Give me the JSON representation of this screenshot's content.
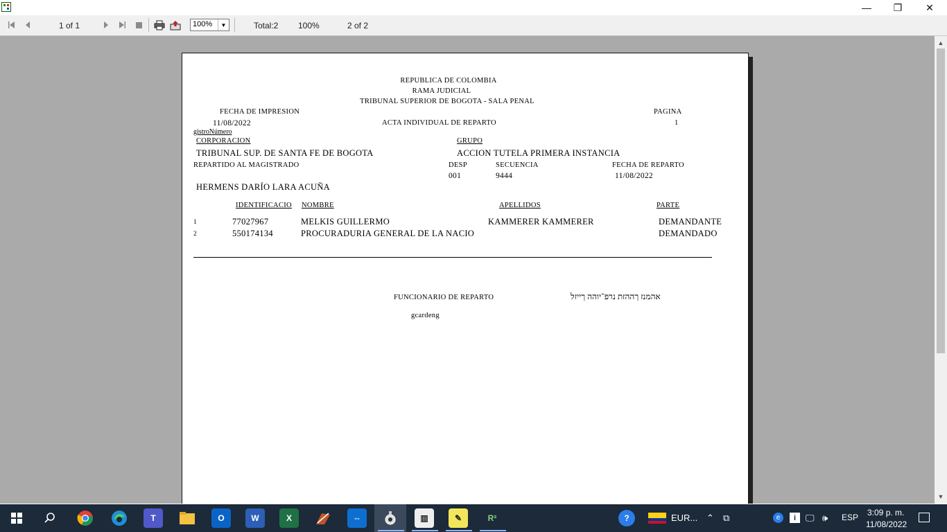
{
  "window": {
    "minimize_glyph": "—",
    "restore_glyph": "❐",
    "close_glyph": "✕"
  },
  "toolbar": {
    "page_indicator": "1 of 1",
    "zoom_value": "100%",
    "total": "Total:2",
    "percent": "100%",
    "records": "2 of 2",
    "icons": [
      "first-page-icon",
      "prev-page-icon",
      "next-page-icon",
      "last-page-icon",
      "stop-icon",
      "print-icon",
      "export-icon"
    ]
  },
  "report": {
    "header_line1": "REPUBLICA DE COLOMBIA",
    "header_line2": "RAMA JUDICIAL",
    "header_line3": "TRIBUNAL SUPERIOR DE BOGOTA - SALA PENAL",
    "fecha_impresion_label": "FECHA DE IMPRESION",
    "fecha_impresion_value": "11/08/2022",
    "pagina_label": "PAGINA",
    "pagina_value": "1",
    "acta_title": "ACTA INDIVIDUAL DE REPARTO",
    "registro_label": "gistroNúmero",
    "corporacion_label": "CORPORACION",
    "corporacion_value": "TRIBUNAL SUP. DE SANTA FE DE BOGOTA",
    "grupo_label": "GRUPO",
    "grupo_value": "ACCION TUTELA PRIMERA INSTANCIA",
    "repartido_label": "REPARTIDO AL MAGISTRADO",
    "desp_label": "DESP",
    "desp_value": "001",
    "secuencia_label": "SECUENCIA",
    "secuencia_value": "9444",
    "fecha_reparto_label": "FECHA DE REPARTO",
    "fecha_reparto_value": "11/08/2022",
    "magistrado": "HERMENS DARÍO LARA ACUÑA",
    "columns": {
      "identificacion": "IDENTIFICACIO",
      "nombre": "NOMBRE",
      "apellidos": "APELLIDOS",
      "parte": "PARTE"
    },
    "rows": [
      {
        "num": "1",
        "id": "77027967",
        "nombre": "MELKIS GUILLERMO",
        "apellidos": "KAMMERER KAMMERER",
        "parte": "DEMANDANTE"
      },
      {
        "num": "2",
        "id": "550174134",
        "nombre": "PROCURADURIA GENERAL DE LA NACIO",
        "apellidos": "",
        "parte": "DEMANDADO"
      }
    ],
    "funcionario_label": "FUNCIONARIO DE REPARTO",
    "hebrew_text": "אהמנז ךההזת נרפ־יוהה ךייזל",
    "usuario": "gcardeng"
  },
  "taskbar": {
    "apps": [
      "start-icon",
      "search-icon",
      "chrome-icon",
      "edge-icon",
      "teams-icon",
      "file-explorer-icon",
      "outlook-icon",
      "word-icon",
      "excel-icon",
      "paint-app-icon",
      "teamviewer-icon",
      "ocr-app-icon",
      "report-app-icon",
      "notes-app-icon",
      "r2r-app-icon"
    ],
    "help_glyph": "?",
    "language_label": "EUR...",
    "lang_code": "ESP",
    "time": "3:09 p. m.",
    "date": "11/08/2022"
  }
}
